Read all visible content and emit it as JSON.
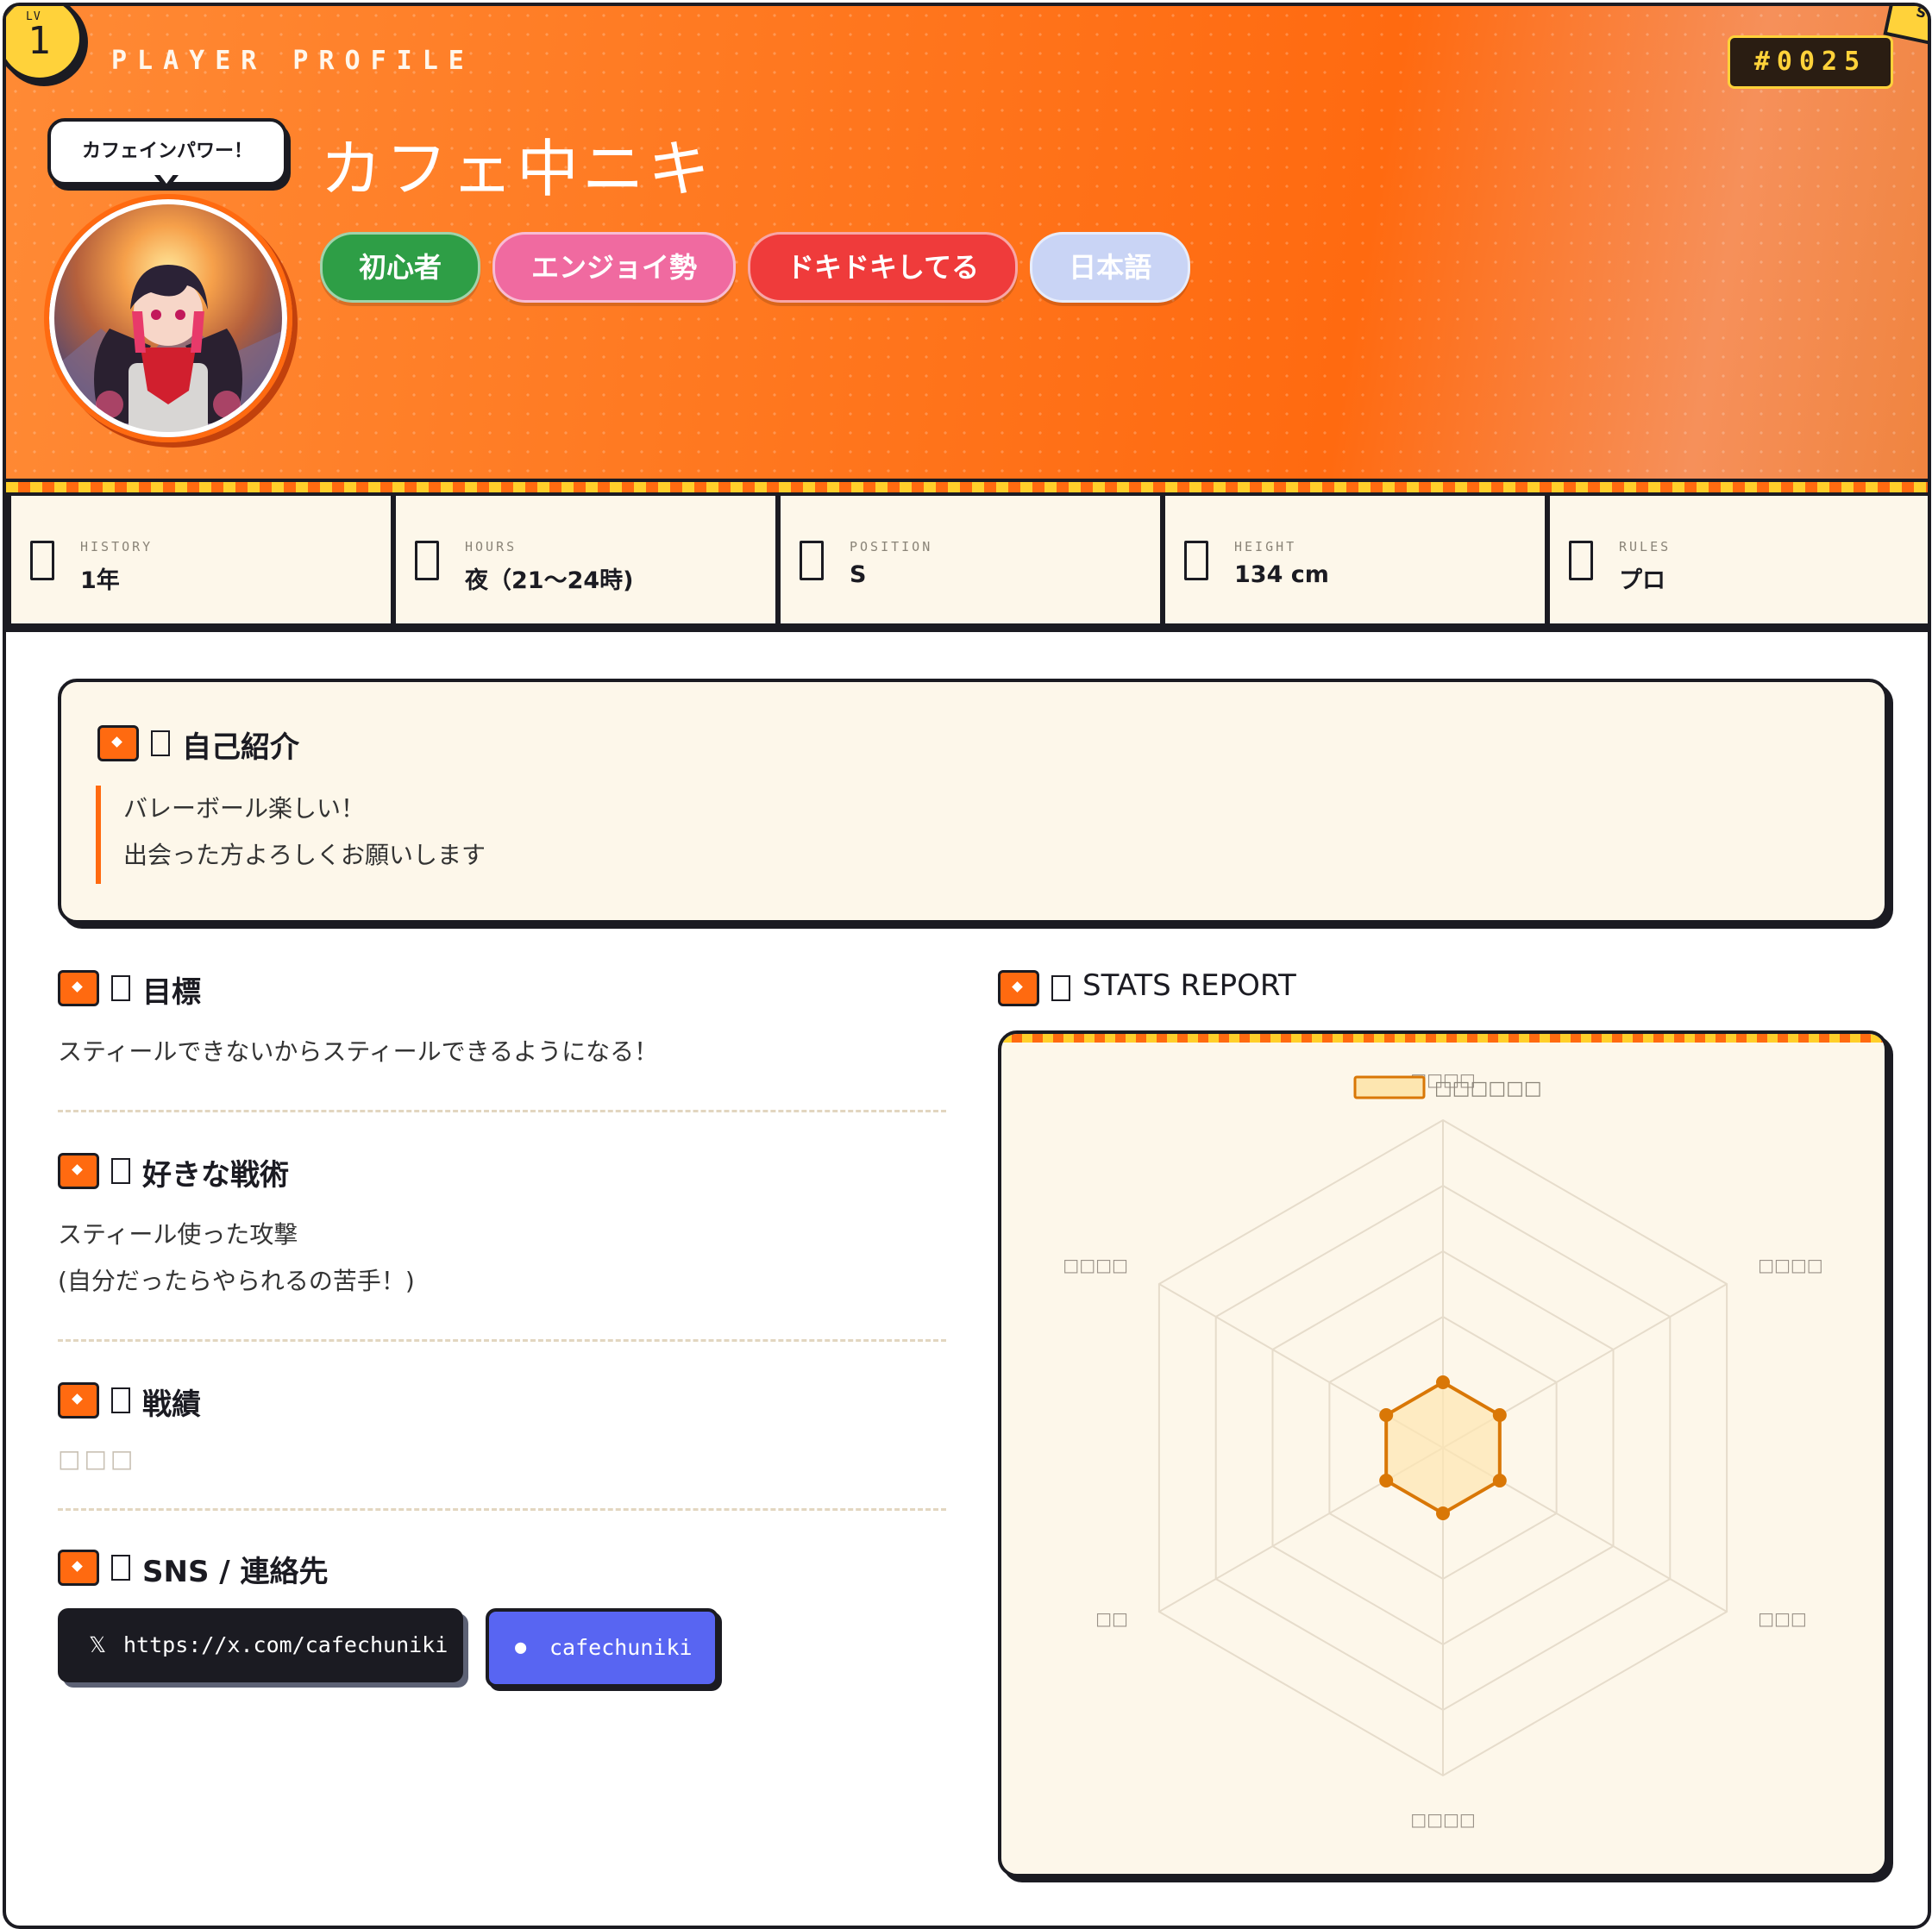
{
  "header": {
    "level_label": "LV",
    "level": "1",
    "section_label": "PLAYER PROFILE",
    "player_id": "#0025",
    "corner_label": "S",
    "speech_bubble": "カフェインパワー！",
    "player_name": "カフェ中ニキ",
    "tags": [
      {
        "label": "初心者",
        "color": "#2e9e46"
      },
      {
        "label": "エンジョイ勢",
        "color": "#f06aa0"
      },
      {
        "label": "ドキドキしてる",
        "color": "#ef3b3b"
      },
      {
        "label": "日本語",
        "color": "#c9d4f5"
      }
    ]
  },
  "info": [
    {
      "label": "HISTORY",
      "value": "1年",
      "icon": "box-icon"
    },
    {
      "label": "HOURS",
      "value": "夜（21〜24時)",
      "icon": "box-icon"
    },
    {
      "label": "POSITION",
      "value": "S",
      "icon": "box-icon"
    },
    {
      "label": "HEIGHT",
      "value": "134 cm",
      "icon": "box-icon"
    },
    {
      "label": "RULES",
      "value": "プロ",
      "icon": "box-icon"
    }
  ],
  "intro": {
    "title": "自己紹介",
    "lines": [
      "バレーボール楽しい！",
      "出会った方よろしくお願いします"
    ]
  },
  "goal": {
    "title": "目標",
    "text": "スティールできないからスティールできるようになる！"
  },
  "tactics": {
    "title": "好きな戦術",
    "lines": [
      "スティール使った攻撃",
      "(自分だったらやられるの苦手！)"
    ]
  },
  "record": {
    "title": "戦績",
    "placeholder": "□□□"
  },
  "sns": {
    "title": "SNS / 連絡先",
    "x_icon": "𝕏",
    "x_link": "https://x.com/cafechuniki",
    "discord_icon": "●",
    "discord_name": "cafechuniki"
  },
  "stats": {
    "title": "STATS REPORT",
    "legend": "□□□□□□",
    "colors": {
      "stroke": "#d97706",
      "fill": "#fde6b0"
    },
    "chart_data": {
      "type": "radar",
      "axes": [
        "□□□□",
        "□□□□",
        "□□□",
        "□□□□",
        "□□",
        "□□□□"
      ],
      "series": [
        {
          "name": "□□□□□□",
          "values": [
            2,
            2,
            2,
            2,
            2,
            2
          ]
        }
      ],
      "range": [
        0,
        10
      ],
      "rings": 5,
      "legend_position": "top"
    }
  }
}
